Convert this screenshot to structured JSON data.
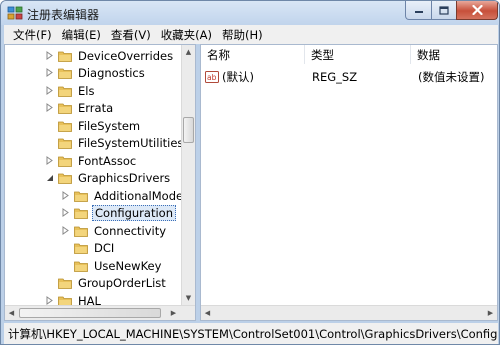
{
  "window": {
    "title": "注册表编辑器"
  },
  "menu": {
    "file": "文件(F)",
    "edit": "编辑(E)",
    "view": "查看(V)",
    "favorites": "收藏夹(A)",
    "help": "帮助(H)"
  },
  "tree": {
    "items": [
      {
        "label": "DeviceOverrides",
        "expander": "collapsed"
      },
      {
        "label": "Diagnostics",
        "expander": "collapsed"
      },
      {
        "label": "Els",
        "expander": "collapsed"
      },
      {
        "label": "Errata",
        "expander": "collapsed"
      },
      {
        "label": "FileSystem",
        "expander": "none"
      },
      {
        "label": "FileSystemUtilities",
        "expander": "none"
      },
      {
        "label": "FontAssoc",
        "expander": "collapsed"
      },
      {
        "label": "GraphicsDrivers",
        "expander": "expanded"
      },
      {
        "label": "AdditionalModel",
        "expander": "collapsed"
      },
      {
        "label": "Configuration",
        "expander": "collapsed",
        "selected": true
      },
      {
        "label": "Connectivity",
        "expander": "collapsed"
      },
      {
        "label": "DCI",
        "expander": "none"
      },
      {
        "label": "UseNewKey",
        "expander": "none"
      },
      {
        "label": "GroupOrderList",
        "expander": "none"
      },
      {
        "label": "HAL",
        "expander": "collapsed"
      }
    ]
  },
  "list": {
    "columns": {
      "name": "名称",
      "type": "类型",
      "data": "数据"
    },
    "rows": [
      {
        "name": "(默认)",
        "type": "REG_SZ",
        "data": "(数值未设置)",
        "icon": "string-value-icon"
      }
    ]
  },
  "status": {
    "path": "计算机\\HKEY_LOCAL_MACHINE\\SYSTEM\\ControlSet001\\Control\\GraphicsDrivers\\Configuratio"
  },
  "colors": {
    "folder": "#e8c15a",
    "selection_border": "#3b6fb8",
    "close_button": "#c7503a"
  }
}
